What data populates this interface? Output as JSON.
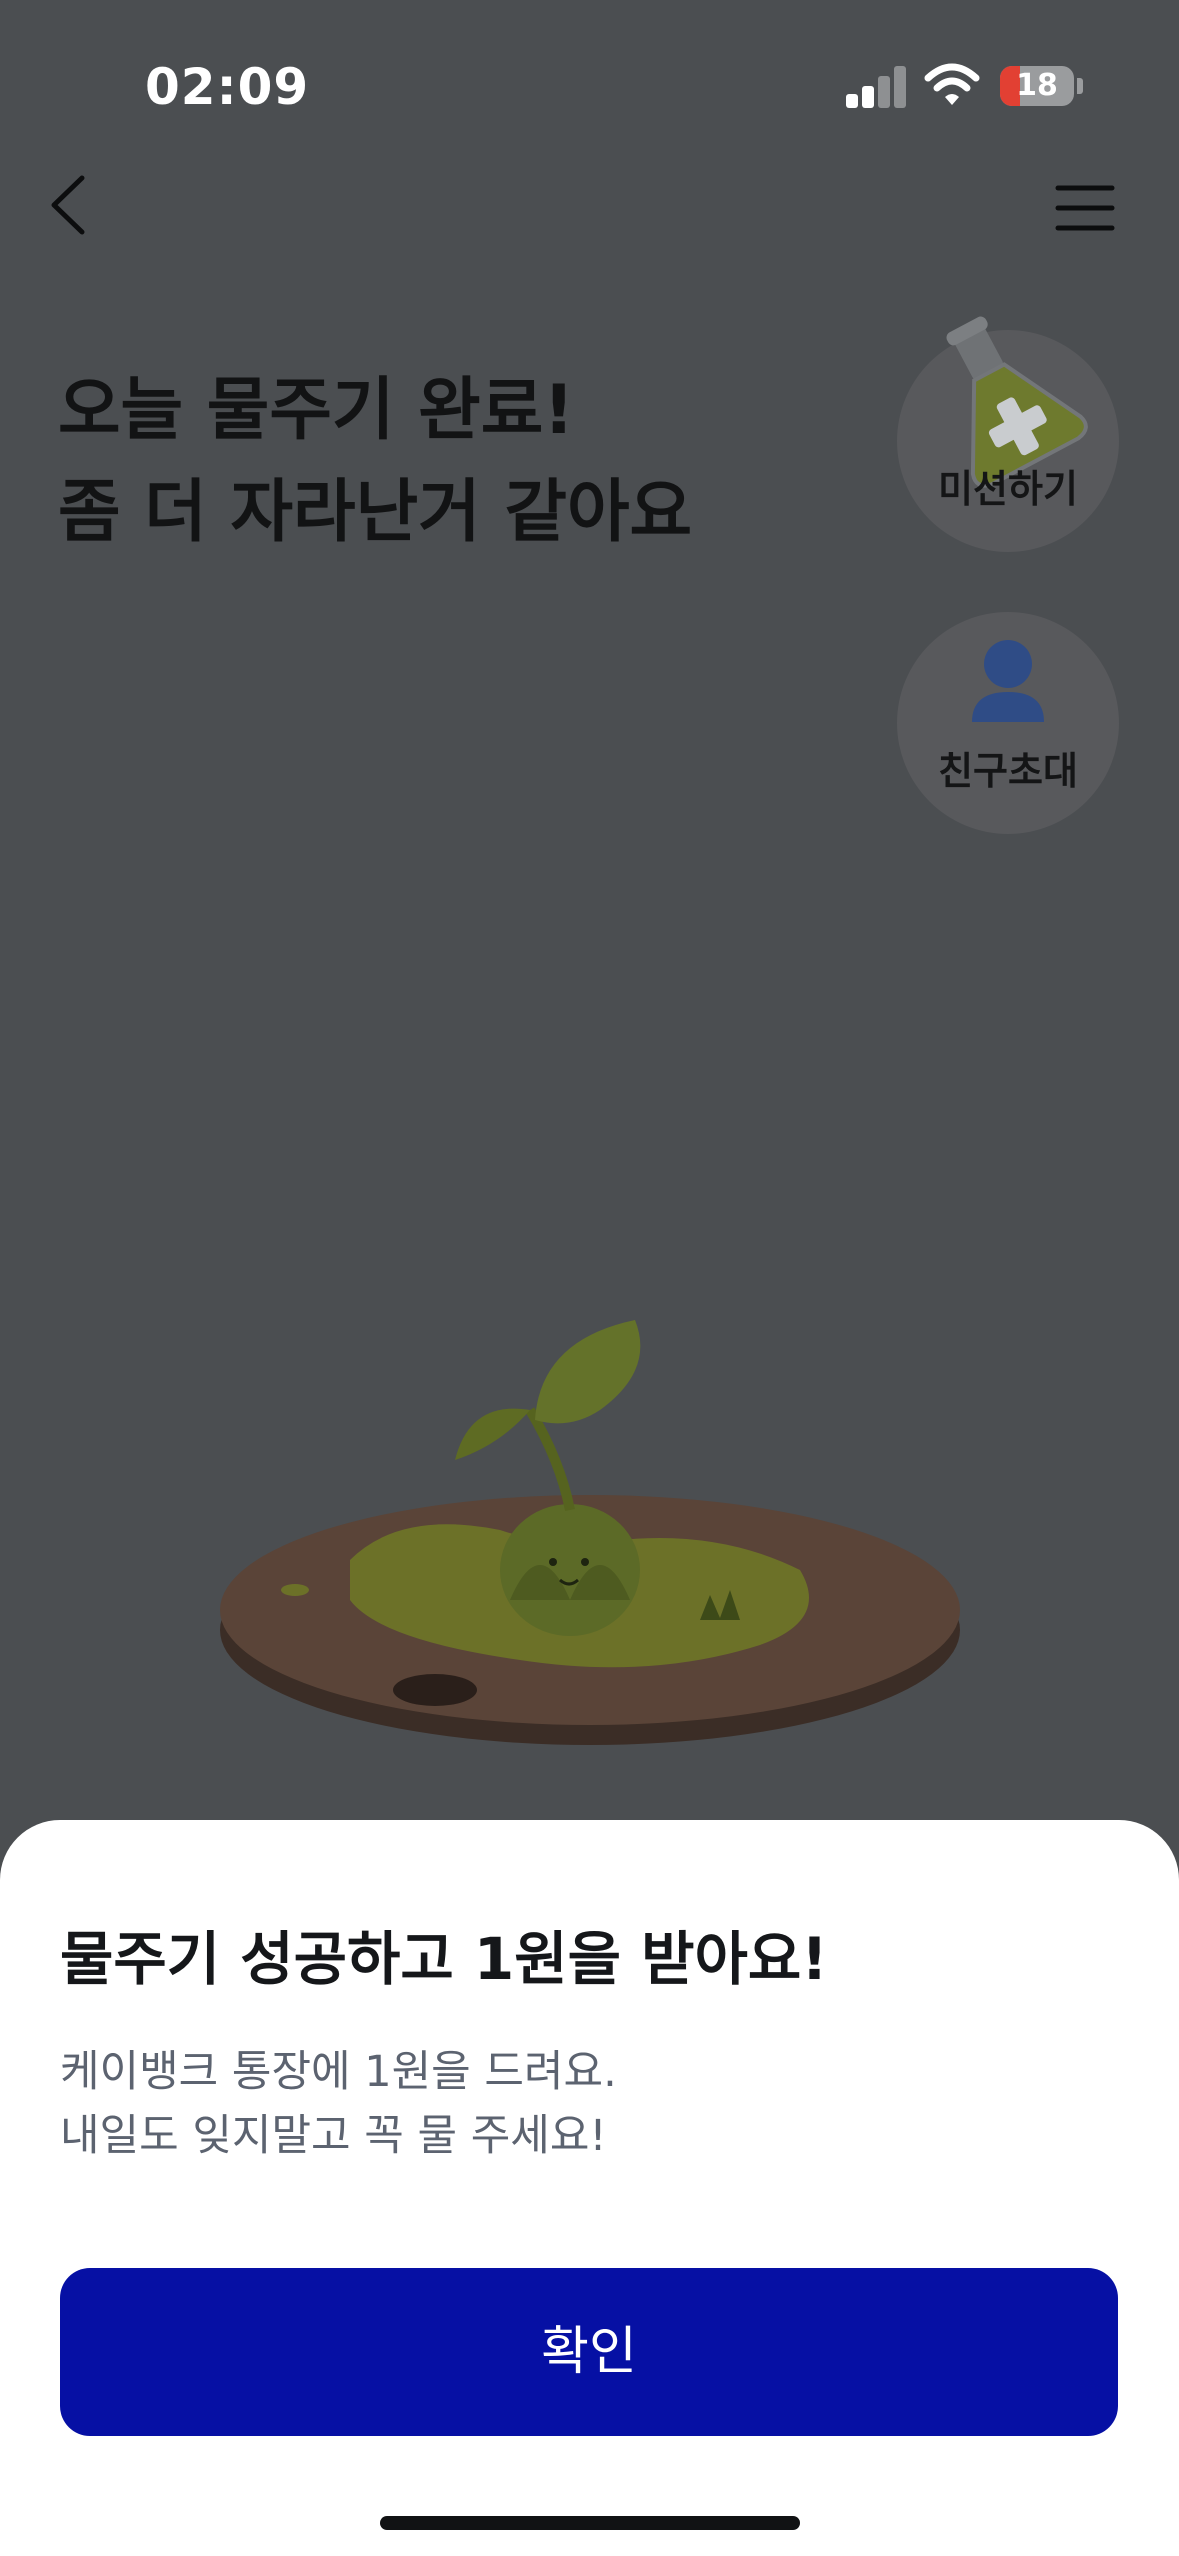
{
  "status_bar": {
    "time": "02:09",
    "battery_level": "18"
  },
  "header": {
    "back_icon": "chevron-left-icon",
    "menu_icon": "hamburger-menu-icon"
  },
  "main": {
    "headline_line1": "오늘 물주기 완료!",
    "headline_line2": "좀 더 자라난거 같아요",
    "mission_label": "미션하기",
    "invite_label": "친구초대"
  },
  "sheet": {
    "title": "물주기 성공하고 1원을 받아요!",
    "desc_line1": "케이뱅크 통장에 1원을 드려요.",
    "desc_line2": "내일도 잊지말고 꼭 물 주세요!",
    "confirm_label": "확인"
  },
  "colors": {
    "accent": "#0610a4",
    "dim_overlay": "#4b4e51",
    "sheet_bg": "#ffffff"
  }
}
